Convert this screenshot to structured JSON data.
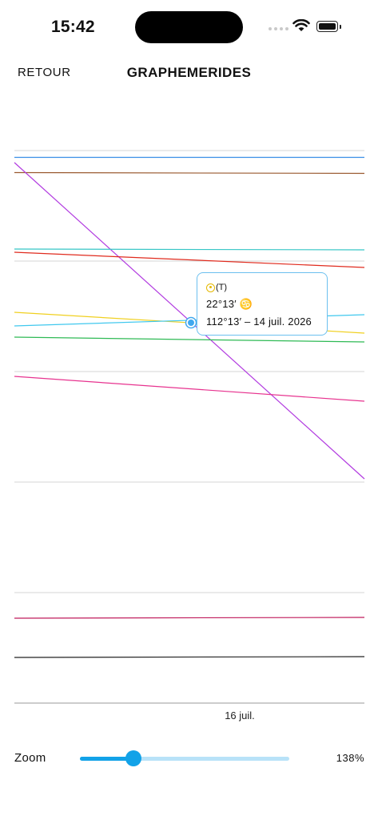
{
  "status": {
    "time": "15:42"
  },
  "nav": {
    "back_label": "RETOUR",
    "title": "GRAPHEMERIDES"
  },
  "chart_data": {
    "type": "line",
    "title": "GRAPHEMERIDES",
    "x_ticks": [
      "16 juil."
    ],
    "grid": true,
    "series": [
      {
        "color": "#3a8ee6",
        "values": [
          196.5,
          196.5
        ]
      },
      {
        "color": "#9a5a30",
        "values": [
          215.5,
          216.5
        ]
      },
      {
        "color": "#b23ce0",
        "values": [
          203,
          598
        ]
      },
      {
        "color": "#36c6c6",
        "values": [
          311,
          312
        ]
      },
      {
        "color": "#e02b1e",
        "values": [
          315,
          334
        ]
      },
      {
        "color": "#f0d020",
        "values": [
          390,
          416
        ]
      },
      {
        "color": "#40c8ee",
        "values": [
          407,
          393
        ]
      },
      {
        "color": "#2fba55",
        "values": [
          421,
          427
        ]
      },
      {
        "color": "#e7338f",
        "values": [
          470,
          501
        ]
      },
      {
        "color": "#c01c5c",
        "values": [
          772,
          771
        ]
      },
      {
        "color": "#222222",
        "values": [
          821,
          820
        ]
      }
    ]
  },
  "tooltip": {
    "planet_symbol": "(T)",
    "position": "22°13′ ♋",
    "longitude_date": "112°13′ – 14 juil. 2026"
  },
  "zoom": {
    "label": "Zoom",
    "value_text": "138%",
    "fraction": 0.255
  }
}
